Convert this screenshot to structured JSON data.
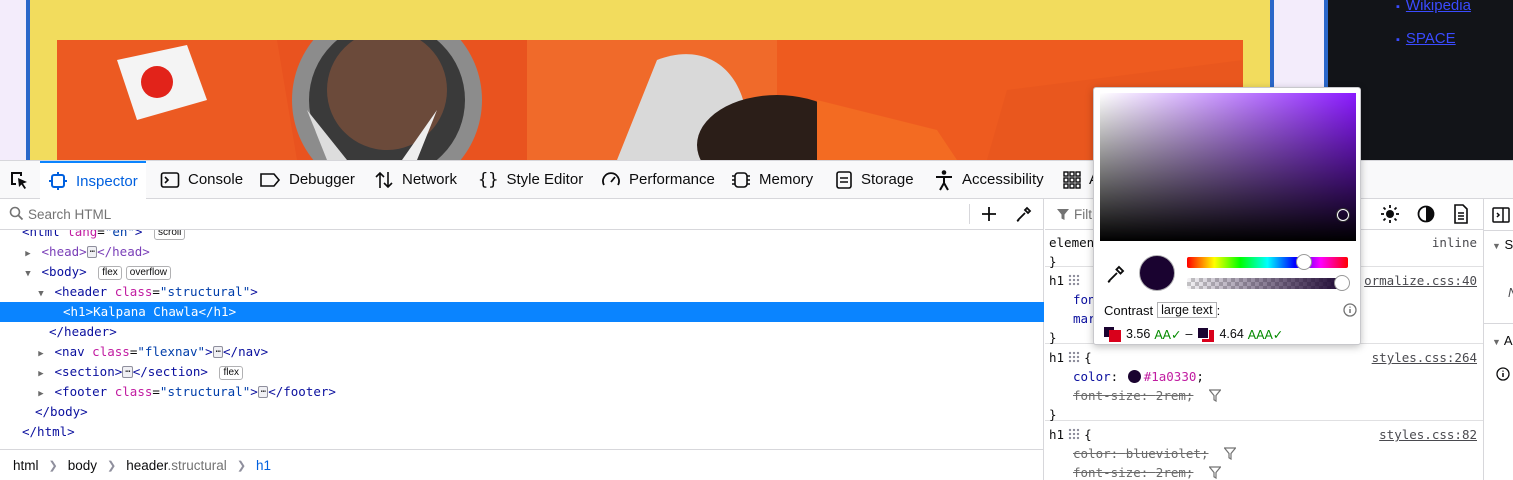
{
  "page": {
    "links": [
      "Wikipedia",
      "SPACE"
    ]
  },
  "toolbar": {
    "tabs": [
      {
        "label": "Inspector",
        "icon": "inspector-icon"
      },
      {
        "label": "Console",
        "icon": "console-icon"
      },
      {
        "label": "Debugger",
        "icon": "debugger-icon"
      },
      {
        "label": "Network",
        "icon": "network-icon"
      },
      {
        "label": "Style Editor",
        "icon": "style-editor-icon"
      },
      {
        "label": "Performance",
        "icon": "performance-icon"
      },
      {
        "label": "Memory",
        "icon": "memory-icon"
      },
      {
        "label": "Storage",
        "icon": "storage-icon"
      },
      {
        "label": "Accessibility",
        "icon": "accessibility-icon"
      },
      {
        "label": "A",
        "icon": "application-icon"
      }
    ]
  },
  "markup": {
    "search_placeholder": "Search HTML",
    "tree": {
      "html_tag": "<html",
      "html_attr": "lang",
      "html_val": "\"en\"",
      "html_close": ">",
      "html_badge": "scroll",
      "head": "<head>",
      "head_close": "</head>",
      "body": "<body>",
      "body_badge1": "flex",
      "body_badge2": "overflow",
      "header": "<header",
      "header_attr": "class",
      "header_val": "\"structural\"",
      "header_gt": ">",
      "h1": "<h1>Kalpana Chawla</h1>",
      "header_close": "</header>",
      "nav": "<nav",
      "nav_attr": "class",
      "nav_val": "\"flexnav\"",
      "nav_gt": ">",
      "nav_close": "</nav>",
      "section": "<section>",
      "section_close": "</section>",
      "section_badge": "flex",
      "footer": "<footer",
      "footer_attr": "class",
      "footer_val": "\"structural\"",
      "footer_gt": ">",
      "footer_close": "</footer>",
      "body_close": "</body>",
      "html_end": "</html>",
      "ellipsis": "⋯"
    },
    "breadcrumbs": {
      "c1": "html",
      "c2": "body",
      "c3_tag": "header",
      "c3_class": ".structural",
      "c4": "h1"
    }
  },
  "rules": {
    "filter_placeholder": "Filt",
    "element_label": "elemen",
    "element_inline": "inline",
    "close_brace": "}",
    "r1": {
      "selector": "h1",
      "source": "normalize.css:40",
      "source_vis": "ormalize.css:40",
      "p1": "fon",
      "p2": "mar"
    },
    "r2": {
      "selector": "h1",
      "source": "styles.css:264",
      "brace": "{",
      "color_prop": "color",
      "color_val": "#1a0330",
      "fs_prop": "font-size",
      "fs_val": "2rem"
    },
    "r3": {
      "selector": "h1",
      "source": "styles.css:82",
      "brace": "{",
      "color_prop": "color",
      "color_val": "blueviolet",
      "fs_prop": "font-size",
      "fs_val": "2rem"
    }
  },
  "picker": {
    "color": "#1a0330",
    "contrast_label": "Contrast",
    "text_size": "large text",
    "colon": ":",
    "ratio1": "3.56",
    "rating1": "AA✓",
    "dash": "–",
    "ratio2": "4.64",
    "rating2": "AAA✓"
  },
  "right_panel": {
    "chev1": "S",
    "chev2": "A"
  },
  "colors": {
    "accent": "#0a84ff",
    "selected_row": "#0a84ff",
    "header_bg": "#f2dc5d"
  }
}
